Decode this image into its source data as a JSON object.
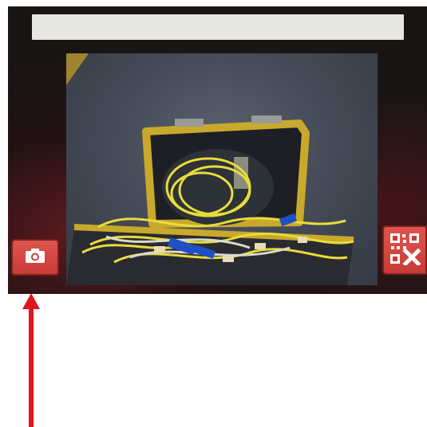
{
  "screen": {
    "status_bar_text": "",
    "capture_button": {
      "icon": "camera-icon",
      "label": ""
    },
    "qr_button": {
      "icon": "qr-cancel-icon",
      "label": ""
    }
  },
  "annotation": {
    "arrow_color": "#e0141c",
    "points_to": "capture-button"
  },
  "colors": {
    "button_red": "#d4473f",
    "status_bar": "#e8e8e2",
    "case_yellow": "#c9a92c",
    "cable_yellow": "#e8dc3a",
    "connector_blue": "#1f4fc4"
  }
}
